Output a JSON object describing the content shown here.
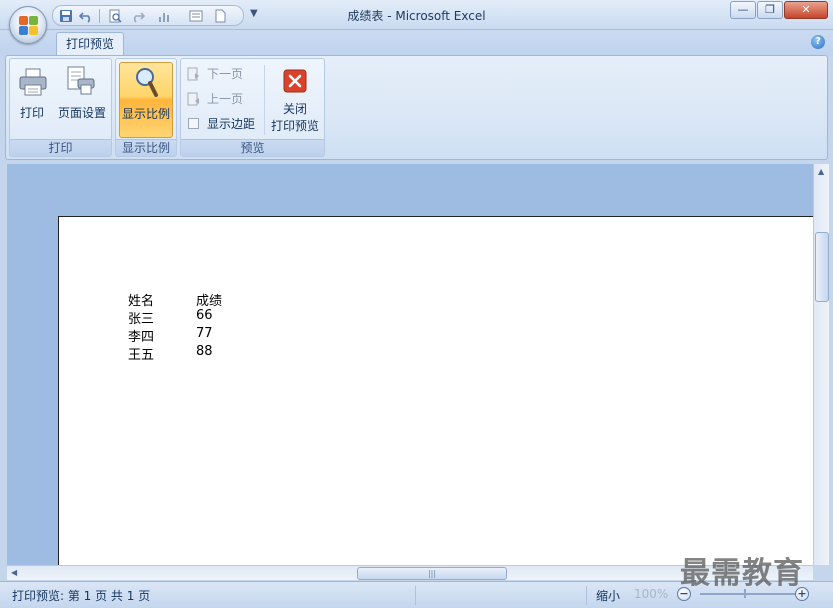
{
  "window": {
    "title": "成绩表 - Microsoft Excel",
    "minimize_label": "—",
    "restore_label": "❐",
    "close_label": "✕"
  },
  "ribbon": {
    "active_tab": "打印预览",
    "help_label": "?",
    "groups": {
      "print": {
        "label": "打印",
        "print_button": "打印",
        "page_setup_button": "页面设置"
      },
      "zoom": {
        "label": "显示比例",
        "zoom_button": "显示比例"
      },
      "preview": {
        "label": "预览",
        "next_page": "下一页",
        "prev_page": "上一页",
        "show_margins": "显示边距",
        "close_preview_line1": "关闭",
        "close_preview_line2": "打印预览"
      }
    }
  },
  "sheet": {
    "headers": [
      "姓名",
      "成绩"
    ],
    "rows": [
      [
        "张三",
        "66"
      ],
      [
        "李四",
        "77"
      ],
      [
        "王五",
        "88"
      ]
    ]
  },
  "status": {
    "text": "打印预览: 第 1 页  共 1 页",
    "zoom_out_label": "缩小",
    "zoom_percent": "100%",
    "zoom_minus": "−",
    "zoom_plus": "+"
  },
  "watermark": "最需教育",
  "colors": {
    "ribbon_bg": "#dbe7f6",
    "active_button": "#ffd46a",
    "preview_bg": "#9ebbe2",
    "close_icon": "#d9432b"
  },
  "icons": [
    "office-button-icon",
    "save-icon",
    "undo-icon",
    "print-preview-icon",
    "redo-icon",
    "print-icon",
    "page-setup-icon",
    "zoom-icon",
    "next-page-icon",
    "previous-page-icon",
    "close-preview-icon",
    "help-icon"
  ]
}
